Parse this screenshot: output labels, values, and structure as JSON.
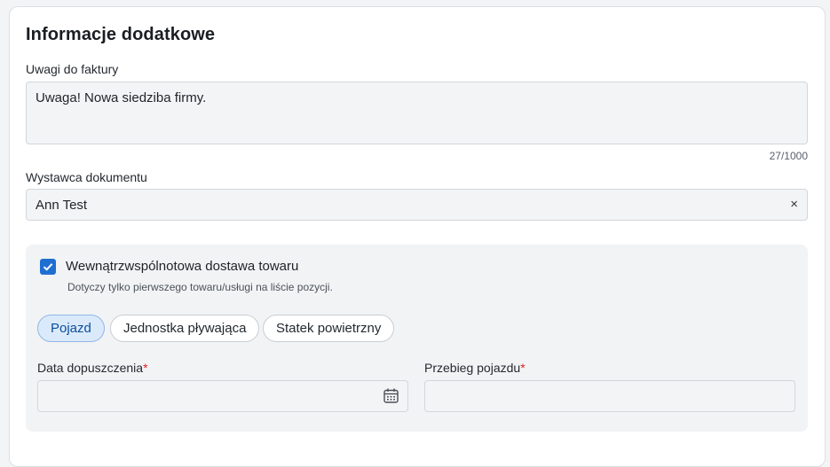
{
  "section": {
    "title": "Informacje dodatkowe"
  },
  "notes": {
    "label": "Uwagi do faktury",
    "value": "Uwaga! Nowa siedziba firmy.",
    "counter": "27/1000"
  },
  "issuer": {
    "label": "Wystawca dokumentu",
    "value": "Ann Test",
    "clear_icon": "×"
  },
  "intra_eu": {
    "checked": true,
    "label": "Wewnątrzwspólnotowa dostawa towaru",
    "help": "Dotyczy tylko pierwszego towaru/usługi na liście pozycji.",
    "vehicle_types": [
      "Pojazd",
      "Jednostka pływająca",
      "Statek powietrzny"
    ],
    "selected_vehicle": "Pojazd",
    "admission_date": {
      "label": "Data dopuszczenia",
      "required_mark": "*",
      "value": "",
      "icon": "calendar-icon"
    },
    "mileage": {
      "label": "Przebieg pojazdu",
      "required_mark": "*",
      "value": ""
    }
  },
  "colors": {
    "accent": "#1f6fd1",
    "chip_active_bg": "#dbeafb",
    "required": "#dd2222"
  }
}
